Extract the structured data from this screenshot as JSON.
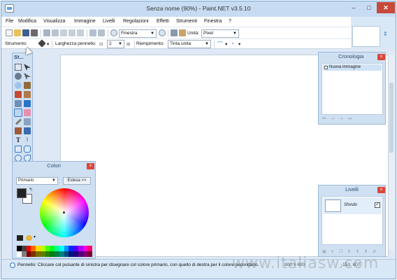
{
  "window": {
    "title": "Senza nome (90%) - Paint.NET v3.5.10",
    "minimize": "–",
    "maximize": "□",
    "close": "✕"
  },
  "menu": [
    "File",
    "Modifica",
    "Visualizza",
    "Immagine",
    "Livelli",
    "Regolazioni",
    "Effetti",
    "Strumenti",
    "Finestra",
    "?"
  ],
  "toolbar": {
    "zoom_mode": "Finestra",
    "units_label": "Unità:",
    "units_value": "Pixel"
  },
  "tool_options": {
    "tool_label": "Strumento:",
    "brush_width_label": "Larghezza pennello:",
    "brush_width_value": "2",
    "fill_label": "Riempimento:",
    "fill_value": "Tinta unita"
  },
  "panels": {
    "tools_title": "St...",
    "colors_title": "Colori",
    "colors_mode": "Primario",
    "colors_extend": "Estesa >>",
    "history_title": "Cronologia",
    "history_items": [
      "Nuova immagine"
    ],
    "layers_title": "Livelli",
    "layers": [
      {
        "name": "Sfondo",
        "visible": true
      }
    ]
  },
  "status": {
    "message": "Pennello: Cliccare col pulsante di sinistra per disegnare col colore primario, con quello di destra per il colore secondario.",
    "image_size": "800 × 600",
    "pointer": "-153, 607"
  },
  "watermark": "www.italiasw.com",
  "colors": {
    "accent": "#3a79c4",
    "close_red": "#c7493a",
    "panel_bg": "#cfe0f2",
    "primary_color": "#222222",
    "secondary_color": "#ffffff"
  }
}
